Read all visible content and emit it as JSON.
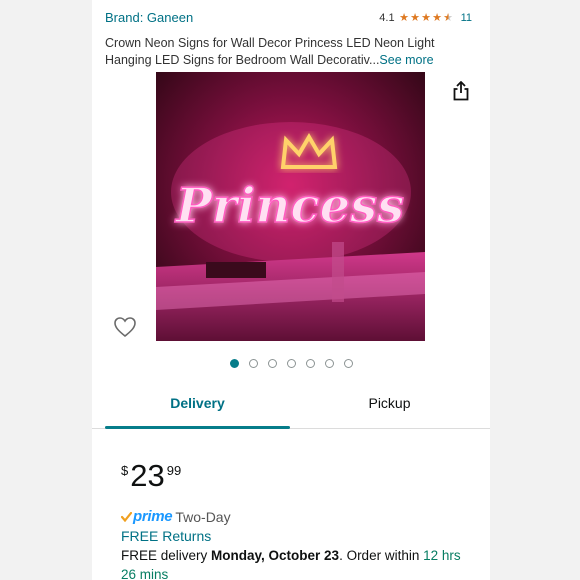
{
  "header": {
    "brand": "Brand: Ganeen",
    "rating_value": "4.1",
    "rating_stars": 4.1,
    "rating_count": "11"
  },
  "product": {
    "title": "Crown Neon Signs for Wall Decor Princess LED Neon Light Hanging LED Signs for Bedroom Wall Decorativ...",
    "see_more": "See more",
    "image_text": "Princess"
  },
  "carousel": {
    "dot_count": 7,
    "active_index": 0
  },
  "tabs": {
    "delivery": "Delivery",
    "pickup": "Pickup"
  },
  "price": {
    "symbol": "$",
    "whole": "23",
    "fraction": "99"
  },
  "prime": {
    "label": "prime",
    "suffix": "Two-Day"
  },
  "returns": "FREE Returns",
  "delivery": {
    "prefix": "FREE delivery ",
    "date": "Monday, October 23",
    "middle": ". Order within ",
    "countdown": "12 hrs 26 mins"
  },
  "colors": {
    "link": "#007185",
    "accent": "#067d8a",
    "star": "#de7921",
    "prime_blue": "#1a98ff",
    "countdown_green": "#067d62"
  },
  "icons": {
    "share": "share-icon",
    "wishlist": "heart-icon"
  }
}
